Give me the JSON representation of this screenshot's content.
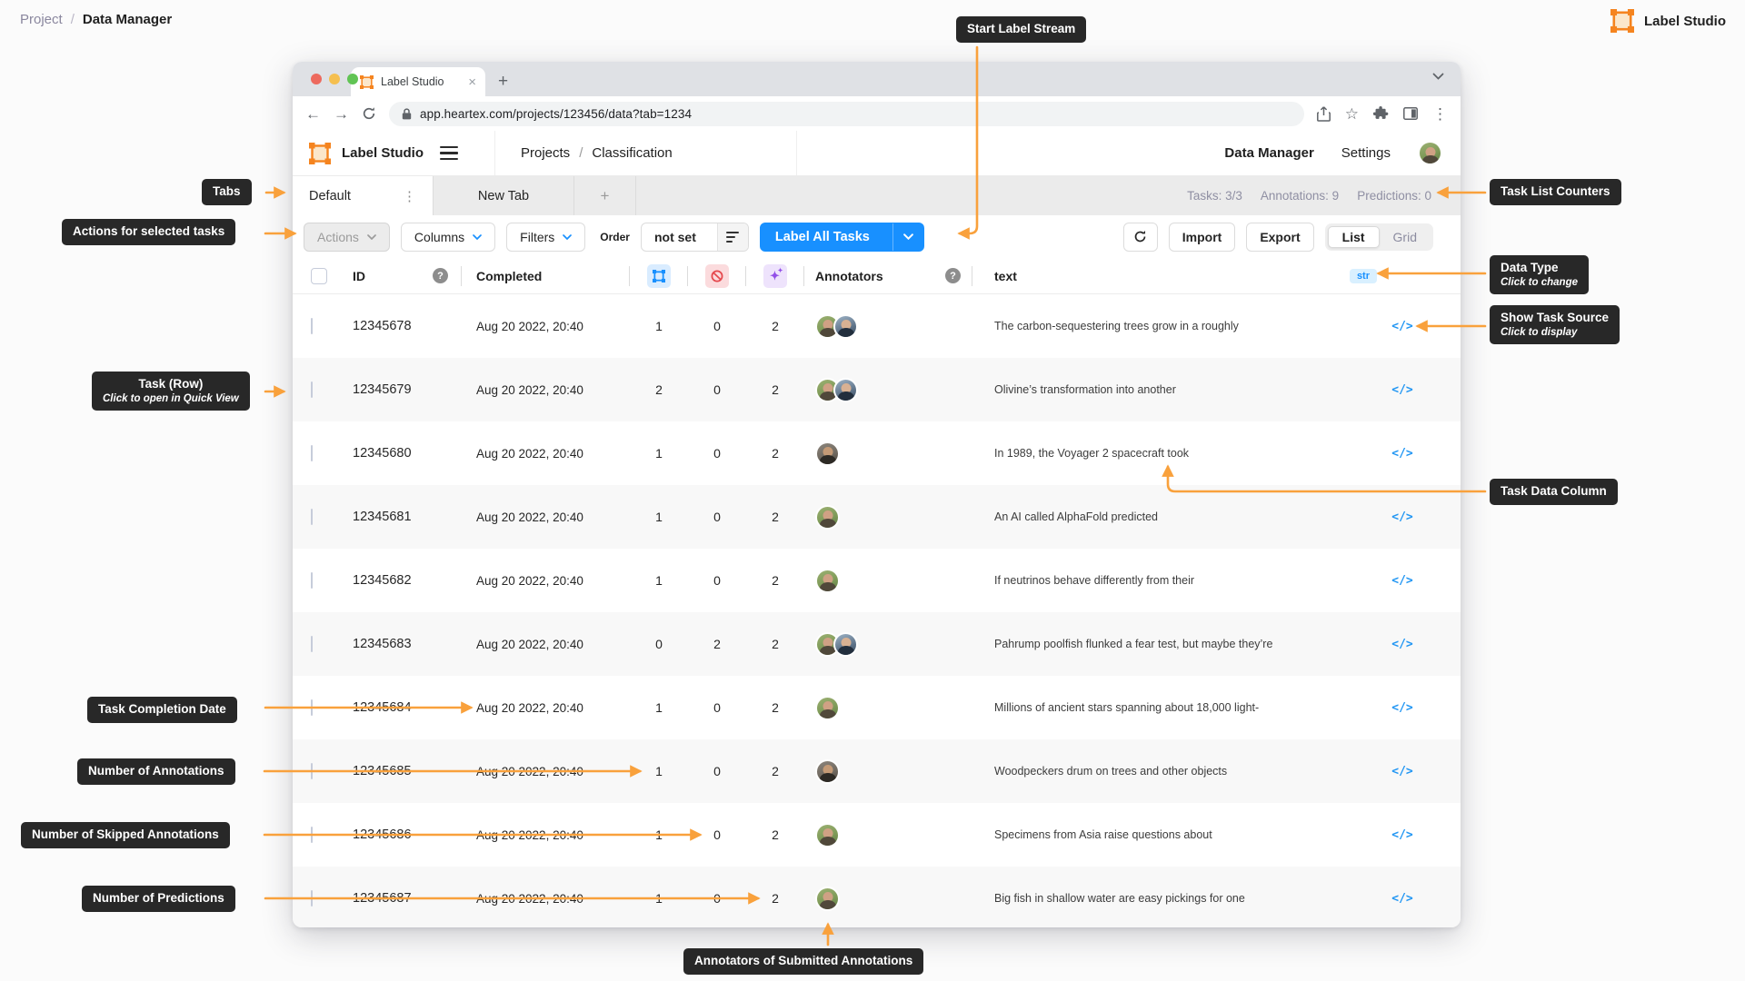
{
  "page": {
    "breadcrumb": {
      "root": "Project",
      "divider": "/",
      "current": "Data Manager"
    },
    "brand": "Label Studio"
  },
  "browser": {
    "tab_title": "Label Studio",
    "url": "app.heartex.com/projects/123456/data?tab=1234"
  },
  "header": {
    "brand": "Label Studio",
    "breadcrumb": {
      "root": "Projects",
      "divider": "/",
      "current": "Classification"
    },
    "nav_data_manager": "Data Manager",
    "nav_settings": "Settings"
  },
  "tabs_row": {
    "tab_default": "Default",
    "tab_new": "New Tab",
    "tab_add": "+",
    "counters": {
      "tasks": "Tasks: 3/3",
      "annotations": "Annotations: 9",
      "predictions": "Predictions: 0"
    }
  },
  "toolbar": {
    "actions": "Actions",
    "columns": "Columns",
    "filters": "Filters",
    "order_label": "Order",
    "order_value": "not set",
    "label_all_tasks": "Label All Tasks",
    "import": "Import",
    "export": "Export",
    "view_list": "List",
    "view_grid": "Grid"
  },
  "table": {
    "headers": {
      "id": "ID",
      "completed": "Completed",
      "annotators": "Annotators",
      "text": "text",
      "data_type_badge": "str"
    },
    "rows": [
      {
        "id": "12345678",
        "completed": "Aug 20 2022, 20:40",
        "annotations": "1",
        "skipped": "0",
        "predictions": "2",
        "annotators": [
          "f",
          "m"
        ],
        "text": "The carbon-sequestering trees grow in a roughly"
      },
      {
        "id": "12345679",
        "completed": "Aug 20 2022, 20:40",
        "annotations": "2",
        "skipped": "0",
        "predictions": "2",
        "annotators": [
          "f",
          "m"
        ],
        "text": "Olivine’s transformation into another"
      },
      {
        "id": "12345680",
        "completed": "Aug 20 2022, 20:40",
        "annotations": "1",
        "skipped": "0",
        "predictions": "2",
        "annotators": [
          "m2"
        ],
        "text": "In 1989, the Voyager 2 spacecraft took"
      },
      {
        "id": "12345681",
        "completed": "Aug 20 2022, 20:40",
        "annotations": "1",
        "skipped": "0",
        "predictions": "2",
        "annotators": [
          "f"
        ],
        "text": "An AI called AlphaFold predicted"
      },
      {
        "id": "12345682",
        "completed": "Aug 20 2022, 20:40",
        "annotations": "1",
        "skipped": "0",
        "predictions": "2",
        "annotators": [
          "f"
        ],
        "text": "If neutrinos behave differently from their"
      },
      {
        "id": "12345683",
        "completed": "Aug 20 2022, 20:40",
        "annotations": "0",
        "skipped": "2",
        "predictions": "2",
        "annotators": [
          "f",
          "m"
        ],
        "text": "Pahrump poolfish flunked a fear test, but maybe they’re"
      },
      {
        "id": "12345684",
        "completed": "Aug 20 2022, 20:40",
        "annotations": "1",
        "skipped": "0",
        "predictions": "2",
        "annotators": [
          "f"
        ],
        "text": "Millions of ancient stars spanning about 18,000 light-"
      },
      {
        "id": "12345685",
        "completed": "Aug 20 2022, 20:40",
        "annotations": "1",
        "skipped": "0",
        "predictions": "2",
        "annotators": [
          "m2"
        ],
        "text": "Woodpeckers drum on trees and other objects"
      },
      {
        "id": "12345686",
        "completed": "Aug 20 2022, 20:40",
        "annotations": "1",
        "skipped": "0",
        "predictions": "2",
        "annotators": [
          "f"
        ],
        "text": "Specimens from Asia raise questions about"
      },
      {
        "id": "12345687",
        "completed": "Aug 20 2022, 20:40",
        "annotations": "1",
        "skipped": "0",
        "predictions": "2",
        "annotators": [
          "f"
        ],
        "text": "Big fish in shallow water are easy pickings for one"
      }
    ]
  },
  "icons": {
    "question": "?",
    "kebab": "⋮",
    "tab_close": "×",
    "new_tab": "+",
    "back": "←",
    "forward": "→",
    "star": "☆",
    "menu_kebab": "⋮",
    "sparkle_large": "✦",
    "sparkle_small": "✦",
    "source": "</>"
  },
  "callouts": {
    "start_label_stream": "Start Label Stream",
    "tabs": "Tabs",
    "task_list_counters": "Task List Counters",
    "actions_for_selected": "Actions for selected tasks",
    "data_type": {
      "title": "Data Type",
      "sub": "Click to change"
    },
    "show_task_source": {
      "title": "Show Task Source",
      "sub": "Click to display"
    },
    "task_row": {
      "title": "Task (Row)",
      "sub": "Click to open in Quick View"
    },
    "task_data_column": "Task Data Column",
    "task_completion_date": "Task Completion Date",
    "number_of_annotations": "Number of Annotations",
    "number_of_skipped": "Number of Skipped Annotations",
    "number_of_predictions": "Number of Predictions",
    "annotators_submitted": "Annotators of Submitted Annotations"
  },
  "colors": {
    "accent_orange": "#F9A13C",
    "brand_orange": "#F5841F",
    "primary_blue": "#1890FF",
    "annotations_icon_blue": "#1890FF",
    "skipped_icon_red": "#E5484D",
    "predictions_icon_purple": "#924FE8",
    "callout_bg": "#282828"
  }
}
